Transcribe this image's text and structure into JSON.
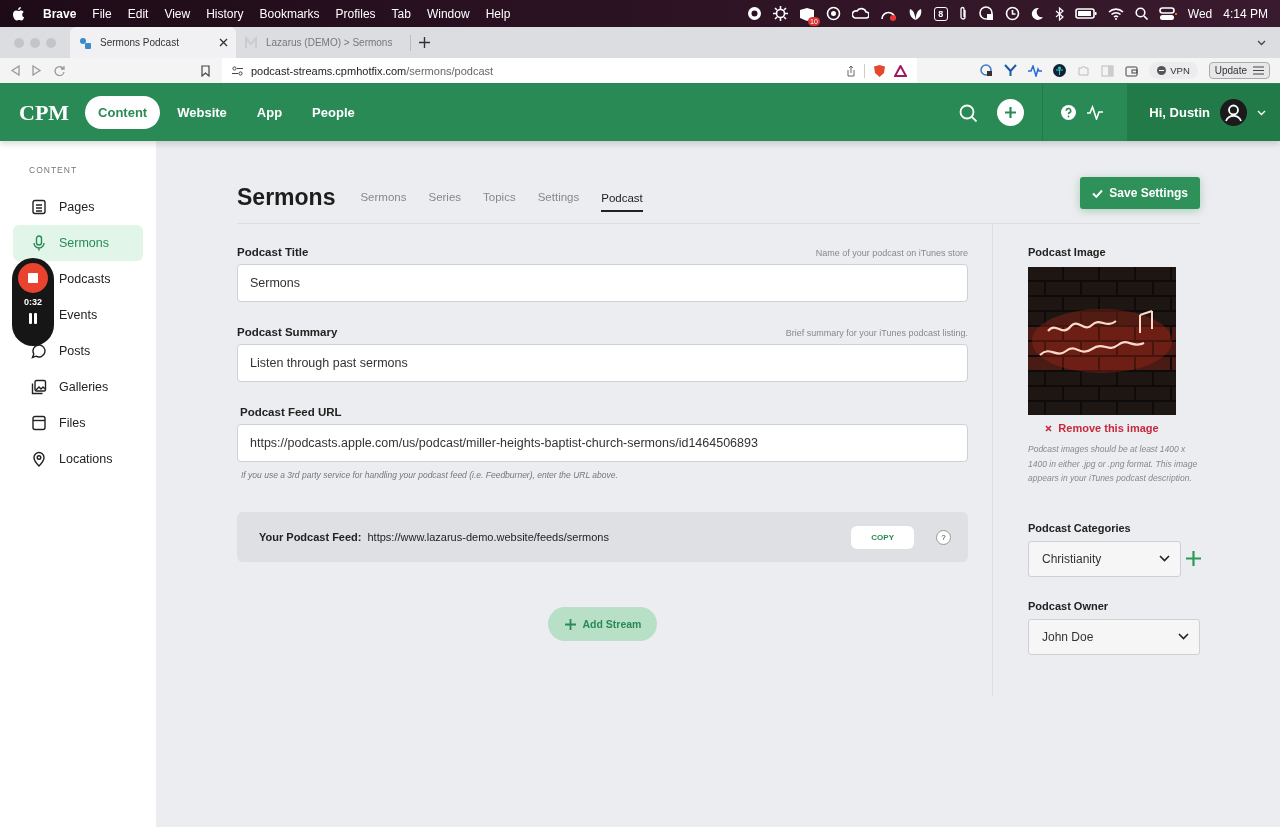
{
  "menubar": {
    "app": "Brave",
    "menus": [
      "File",
      "Edit",
      "View",
      "History",
      "Bookmarks",
      "Profiles",
      "Tab",
      "Window",
      "Help"
    ],
    "badge": "10",
    "calendar_day": "8",
    "day": "Wed",
    "time": "4:14 PM"
  },
  "browser": {
    "tabs": [
      {
        "title": "Sermons Podcast",
        "selected": true
      },
      {
        "title": "Lazarus (DEMO) > Sermons",
        "selected": false
      }
    ],
    "url_host": "podcast-streams.cpmhotfix.com",
    "url_path": "/sermons/podcast",
    "vpn": "VPN",
    "update": "Update"
  },
  "header": {
    "logo": "CPM",
    "nav": [
      {
        "label": "Content",
        "selected": true
      },
      {
        "label": "Website",
        "selected": false
      },
      {
        "label": "App",
        "selected": false
      },
      {
        "label": "People",
        "selected": false
      }
    ],
    "greeting": "Hi, Dustin"
  },
  "sidebar": {
    "heading": "CONTENT",
    "items": [
      {
        "label": "Pages",
        "selected": false
      },
      {
        "label": "Sermons",
        "selected": true
      },
      {
        "label": "Podcasts",
        "selected": false
      },
      {
        "label": "Events",
        "selected": false
      },
      {
        "label": "Posts",
        "selected": false
      },
      {
        "label": "Galleries",
        "selected": false
      },
      {
        "label": "Files",
        "selected": false
      },
      {
        "label": "Locations",
        "selected": false
      }
    ]
  },
  "recorder": {
    "time": "0:32"
  },
  "page": {
    "title": "Sermons",
    "tabs": [
      {
        "label": "Sermons",
        "selected": false
      },
      {
        "label": "Series",
        "selected": false
      },
      {
        "label": "Topics",
        "selected": false
      },
      {
        "label": "Settings",
        "selected": false
      },
      {
        "label": "Podcast",
        "selected": true
      }
    ],
    "save": "Save Settings"
  },
  "fields": [
    {
      "label": "Podcast Title",
      "hint": "Name of your podcast on iTunes store",
      "value": "Sermons"
    },
    {
      "label": "Podcast Summary",
      "hint": "Brief summary for your iTunes podcast listing.",
      "value": "Listen through past sermons"
    },
    {
      "label": "Podcast Feed URL",
      "value": "https://podcasts.apple.com/us/podcast/miller-heights-baptist-church-sermons/id1464506893",
      "note": "If you use a 3rd party service for handling your podcast feed (i.e. Feedburner), enter the URL above."
    }
  ],
  "feed": {
    "label": "Your Podcast Feed:",
    "url": "https://www.lazarus-demo.website/feeds/sermons",
    "copy": "COPY",
    "help": "?"
  },
  "add_stream": "Add Stream",
  "image_panel": {
    "label": "Podcast Image",
    "remove": "Remove this image",
    "note": "Podcast images should be at least 1400 x 1400 in either .jpg or .png format. This image appears in your iTunes podcast description."
  },
  "categories": {
    "label": "Podcast Categories",
    "value": "Christianity"
  },
  "owner": {
    "label": "Podcast Owner",
    "value": "John Doe"
  }
}
